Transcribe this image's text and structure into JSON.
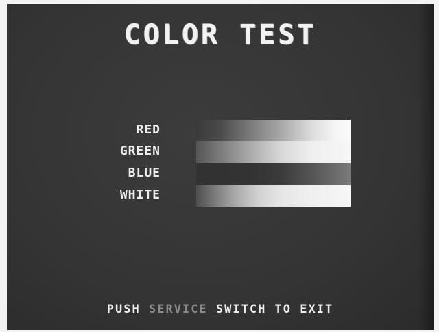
{
  "title": "COLOR TEST",
  "colors": {
    "screen_background": "#363636",
    "text": "#f0f0f0",
    "dim_text": "#8a8a8a"
  },
  "rows": [
    {
      "label": "RED"
    },
    {
      "label": "GREEN"
    },
    {
      "label": "BLUE"
    },
    {
      "label": "WHITE"
    }
  ],
  "footer": {
    "part1": "PUSH",
    "part2": "SERVICE",
    "part3": "SWITCH TO EXIT"
  }
}
